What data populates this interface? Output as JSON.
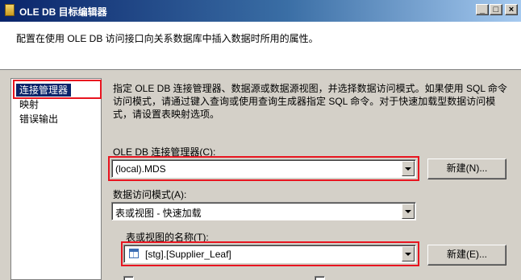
{
  "window": {
    "title": "OLE DB 目标编辑器",
    "minimize": "_",
    "maximize": "□",
    "close": "×"
  },
  "description": "配置在使用 OLE DB 访问接口向关系数据库中插入数据时所用的属性。",
  "sidebar": {
    "items": [
      {
        "label": "连接管理器"
      },
      {
        "label": "映射"
      },
      {
        "label": "错误输出"
      }
    ]
  },
  "content": {
    "help_text": "指定 OLE DB 连接管理器、数据源或数据源视图，并选择数据访问模式。如果使用 SQL 命令访问模式，请通过键入查询或使用查询生成器指定 SQL 命令。对于快速加载型数据访问模式，请设置表映射选项。",
    "connection_manager": {
      "label": "OLE DB 连接管理器(C):",
      "value": "(local).MDS",
      "new_button": "新建(N)..."
    },
    "access_mode": {
      "label": "数据访问模式(A):",
      "value": "表或视图 - 快速加载"
    },
    "table_name": {
      "label": "表或视图的名称(T):",
      "value": "[stg].[Supplier_Leaf]",
      "new_button": "新建(E)..."
    }
  },
  "colors": {
    "highlight": "#e8141f",
    "selection": "#0a246a"
  }
}
